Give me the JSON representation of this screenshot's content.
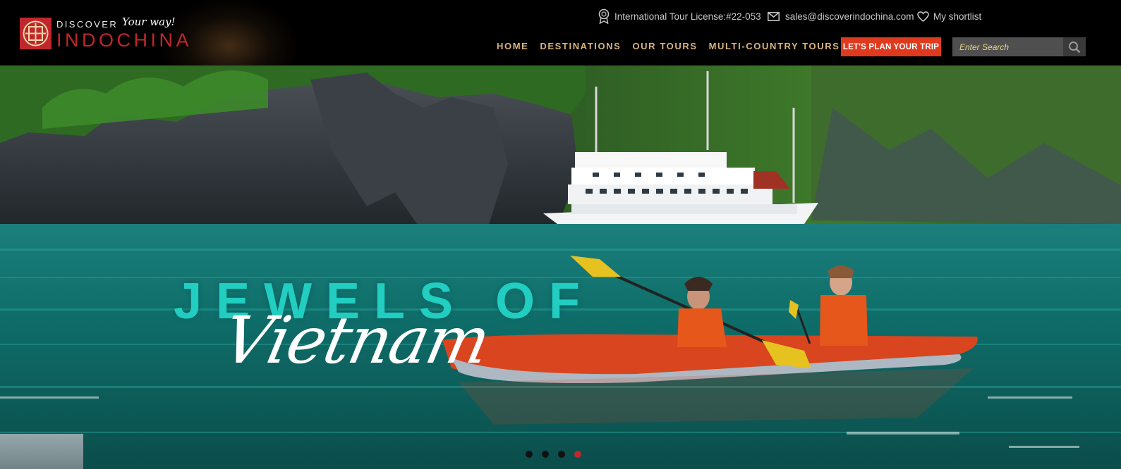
{
  "brand": {
    "top": "DISCOVER",
    "script": "Your way!",
    "main": "INDOCHINA",
    "color": "#c0262d"
  },
  "topbar": {
    "license": "International Tour License:#22-053",
    "email": "sales@discoverindochina.com",
    "shortlist": "My shortlist",
    "icons": [
      "award-icon",
      "mail-icon",
      "heart-icon"
    ]
  },
  "nav": {
    "items": [
      "HOME",
      "DESTINATIONS",
      "OUR TOURS",
      "MULTI-COUNTRY TOURS"
    ],
    "color": "#d9b47a"
  },
  "cta": {
    "label": "LET'S PLAN YOUR TRIP",
    "color": "#e03a1e"
  },
  "search": {
    "placeholder": "Enter Search",
    "icon": "search-icon"
  },
  "hero": {
    "headline": "JEWELS OF",
    "script": "Vietnam",
    "headline_color": "#23d6c8"
  },
  "carousel": {
    "slide_count": 4,
    "active_index": 3
  }
}
